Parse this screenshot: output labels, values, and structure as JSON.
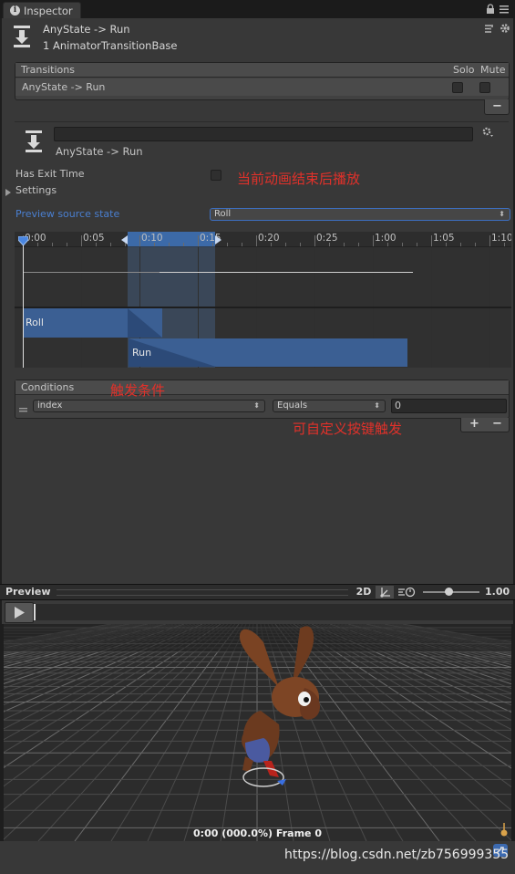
{
  "tab": {
    "label": "Inspector",
    "icon": "info-icon"
  },
  "header": {
    "title": "AnyState -> Run",
    "subtitle": "1 AnimatorTransitionBase"
  },
  "transitions": {
    "header": "Transitions",
    "solo_label": "Solo",
    "mute_label": "Mute",
    "rows": [
      {
        "label": "AnyState -> Run"
      }
    ],
    "remove_label": "−"
  },
  "transition": {
    "name_value": "",
    "label": "AnyState -> Run",
    "has_exit_time_label": "Has Exit Time",
    "has_exit_time_checked": false,
    "has_exit_time_note": "当前动画结束后播放",
    "settings_label": "Settings",
    "preview_source_label": "Preview source state",
    "preview_source_value": "Roll"
  },
  "timeline": {
    "ticks": [
      "0:00",
      "0:05",
      "0:10",
      "0:15",
      "0:20",
      "0:25",
      "1:00",
      "1:05",
      "1:10"
    ],
    "source_state": "Roll",
    "dest_state": "Run"
  },
  "conditions": {
    "header": "Conditions",
    "header_note": "触发条件",
    "rows": [
      {
        "parameter": "index",
        "operator": "Equals",
        "value": "0"
      }
    ],
    "note": "可自定义按键触发",
    "add_label": "+",
    "remove_label": "−"
  },
  "preview": {
    "title": "Preview",
    "mode_2d": "2D",
    "speed_value": "1.00",
    "status": "0:00 (000.0%) Frame 0"
  },
  "watermark": "https://blog.csdn.net/zb756999355",
  "colors": {
    "accent_blue": "#4a7fd0",
    "annotation_red": "#e0312a",
    "state_bar": "#3a5b8c"
  }
}
